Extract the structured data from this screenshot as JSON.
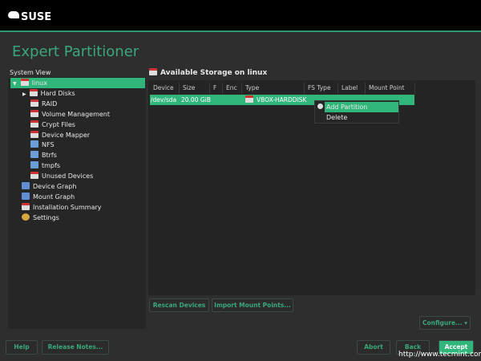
{
  "header": {
    "logo": "SUSE"
  },
  "title": "Expert Partitioner",
  "system_view_label": "System View",
  "tree": [
    {
      "label": "linux",
      "icon": "disk-icon",
      "level": 0,
      "selected": true,
      "expanded": true
    },
    {
      "label": "Hard Disks",
      "icon": "disk-icon",
      "level": 1,
      "expander": true
    },
    {
      "label": "RAID",
      "icon": "disk-icon",
      "level": 1
    },
    {
      "label": "Volume Management",
      "icon": "disk-icon",
      "level": 1
    },
    {
      "label": "Crypt Files",
      "icon": "disk-icon",
      "level": 1
    },
    {
      "label": "Device Mapper",
      "icon": "disk-icon",
      "level": 1
    },
    {
      "label": "NFS",
      "icon": "folder-icon",
      "level": 1
    },
    {
      "label": "Btrfs",
      "icon": "folder-icon",
      "level": 1
    },
    {
      "label": "tmpfs",
      "icon": "folder-icon",
      "level": 1
    },
    {
      "label": "Unused Devices",
      "icon": "disk-icon",
      "level": 1
    },
    {
      "label": "Device Graph",
      "icon": "graph-icon",
      "level": 0
    },
    {
      "label": "Mount Graph",
      "icon": "graph-icon",
      "level": 0
    },
    {
      "label": "Installation Summary",
      "icon": "disk-icon",
      "level": 0
    },
    {
      "label": "Settings",
      "icon": "wrench-icon",
      "level": 0
    }
  ],
  "storage": {
    "title": "Available Storage on linux",
    "columns": [
      "Device",
      "Size",
      "F",
      "Enc",
      "Type",
      "FS Type",
      "Label",
      "Mount Point"
    ],
    "rows": [
      {
        "device": "/dev/sda",
        "size": "20.00 GiB",
        "f": "",
        "enc": "",
        "type": "VBOX-HARDDISK",
        "fs_type": "",
        "label": "",
        "mount": ""
      }
    ]
  },
  "context_menu": [
    "Add Partition",
    "Delete"
  ],
  "buttons": {
    "rescan": "Rescan Devices",
    "import": "Import Mount Points...",
    "configure": "Configure...",
    "help": "Help",
    "release_notes": "Release Notes...",
    "abort": "Abort",
    "back": "Back",
    "accept": "Accept"
  },
  "watermark": "http://www.tecmint.com",
  "colors": {
    "accent": "#30b67a",
    "title": "#3aa77a"
  }
}
